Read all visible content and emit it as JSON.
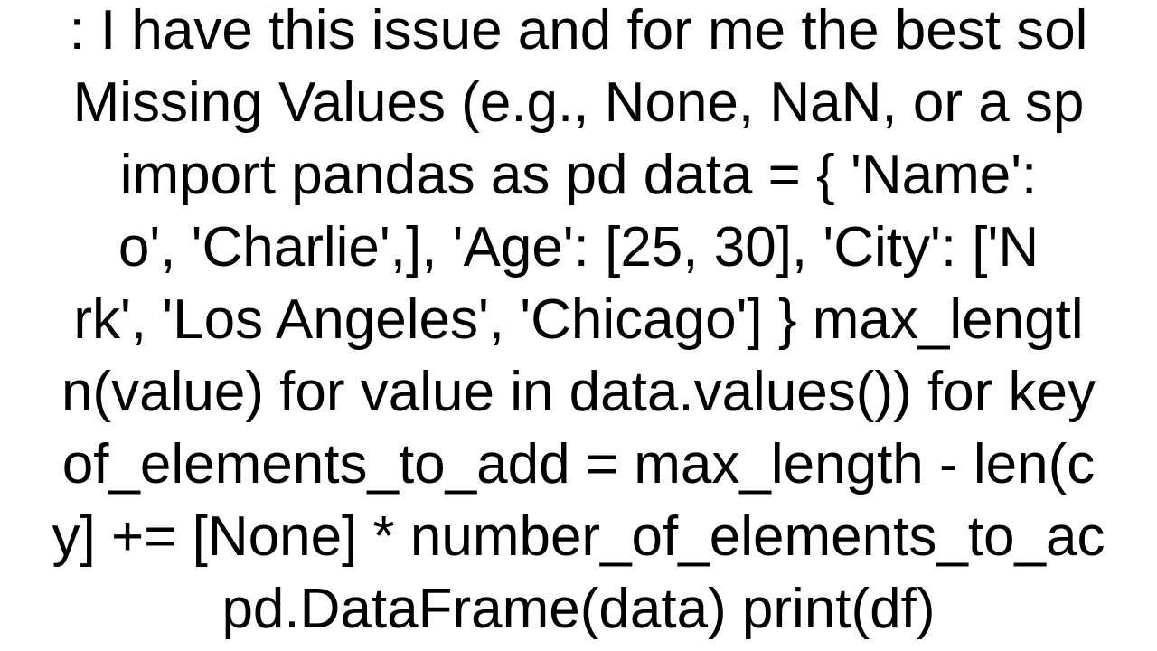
{
  "line1": ": I have this issue and for me the best sol",
  "line2": "Missing Values (e.g., None, NaN, or a sp",
  "line3": "import pandas as pd   data = {     'Name': ",
  "line4": "o', 'Charlie',],     'Age': [25, 30],     'City': ['N",
  "line5": "rk', 'Los Angeles', 'Chicago'] }  max_lengtl",
  "line6": "n(value) for value in data.values()) for key",
  "line7": "of_elements_to_add = max_length - len(c",
  "line8": "y] += [None] * number_of_elements_to_ac",
  "line9": "pd.DataFrame(data) print(df)"
}
